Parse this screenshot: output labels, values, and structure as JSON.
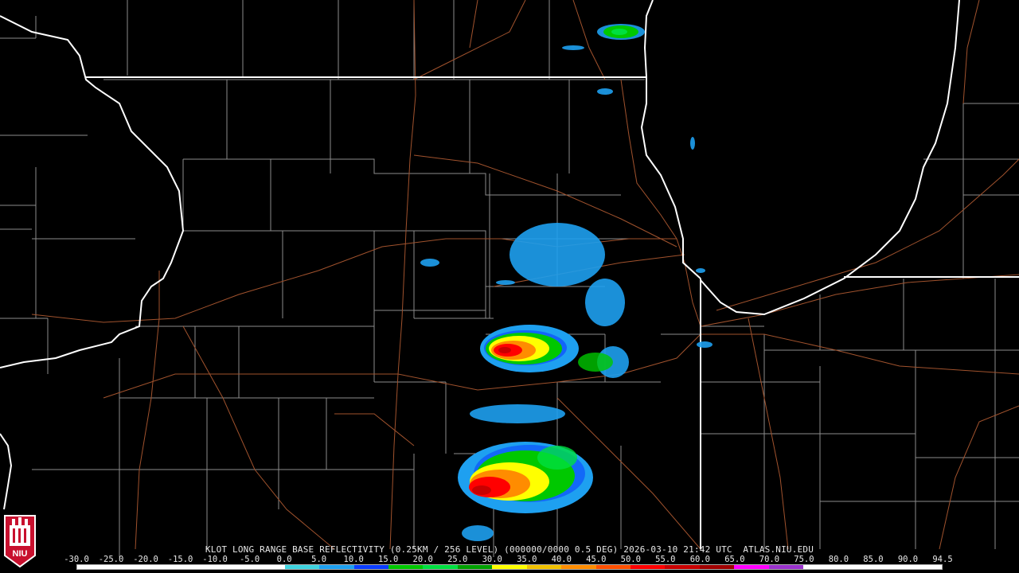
{
  "product": {
    "caption": "KLOT LONG RANGE BASE REFLECTIVITY (0.25KM / 256 LEVEL) (000000/0000 0.5 DEG) 2026-03-10 21:42 UTC  ATLAS.NIU.EDU"
  },
  "logo": {
    "text": "NIU"
  },
  "scale": {
    "labels": [
      "-30.0",
      "-25.0",
      "-20.0",
      "-15.0",
      "-10.0",
      "-5.0",
      "0.0",
      "5.0",
      "10.0",
      "15.0",
      "20.0",
      "25.0",
      "30.0",
      "35.0",
      "40.0",
      "45.0",
      "50.0",
      "55.0",
      "60.0",
      "65.0",
      "70.0",
      "75.0",
      "80.0",
      "85.0",
      "90.0",
      "94.5"
    ],
    "colors": [
      "#ffffff",
      "#ffffff",
      "#ffffff",
      "#ffffff",
      "#ffffff",
      "#ffffff",
      "#3fd4e0",
      "#1ea0f0",
      "#0a3cff",
      "#00c800",
      "#00e040",
      "#00a000",
      "#ffff00",
      "#f0c000",
      "#ff8c00",
      "#ff5000",
      "#ff0000",
      "#c80000",
      "#a00000",
      "#ff00ff",
      "#9a32cd",
      "#ffffff",
      "#ffffff",
      "#ffffff",
      "#ffffff"
    ]
  },
  "map_colors": {
    "state_lines": "#ffffff",
    "county_lines": "#8c8c8c",
    "roads": "#a0522d"
  }
}
